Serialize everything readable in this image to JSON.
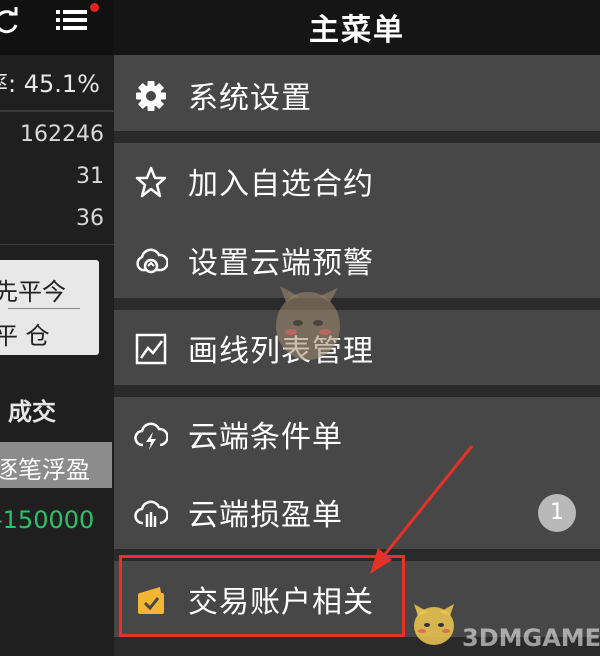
{
  "left_panel": {
    "ratio_text": "率: 45.1%",
    "numbers": [
      "162246",
      "31",
      "36"
    ],
    "close_today_label": "先平今",
    "close_position_label": "平 仓",
    "deal_label": "成交",
    "per_trade_profit_label": "逐笔浮盈",
    "profit_value": "-150000",
    "profit_color": "#29c36a"
  },
  "menu": {
    "title": "主菜单",
    "items": [
      {
        "label": "系统设置",
        "icon": "gear-icon"
      },
      {
        "label": "加入自选合约",
        "icon": "star-icon"
      },
      {
        "label": "设置云端预警",
        "icon": "cloud-alert-icon"
      },
      {
        "label": "画线列表管理",
        "icon": "chart-line-icon"
      },
      {
        "label": "云端条件单",
        "icon": "cloud-lightning-icon"
      },
      {
        "label": "云端损盈单",
        "icon": "cloud-stop-icon",
        "badge": "1"
      },
      {
        "label": "交易账户相关",
        "icon": "wallet-check-icon"
      }
    ]
  },
  "colors": {
    "highlight_box": "#e53126",
    "wallet_icon": "#f2b632",
    "notification_dot": "#e0231f"
  },
  "watermark": {
    "text": "3DMGAME"
  }
}
